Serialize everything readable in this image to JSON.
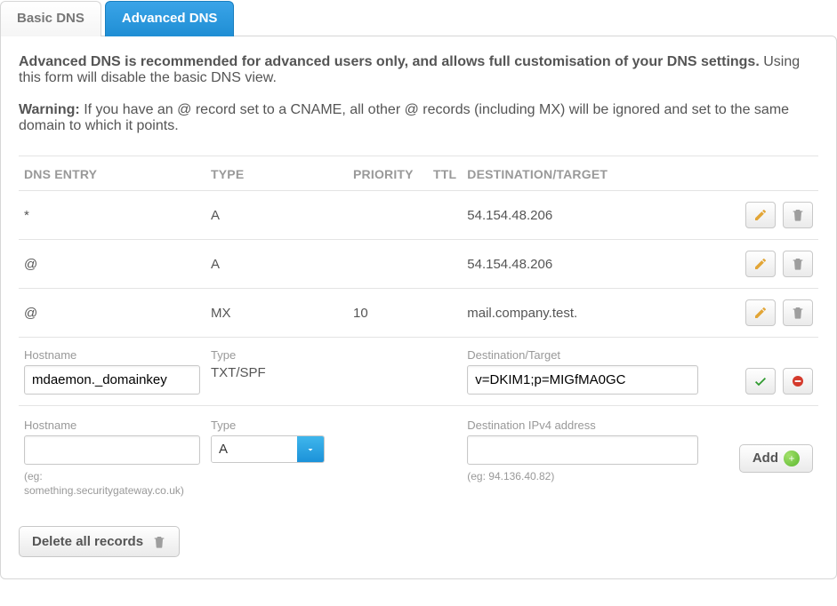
{
  "tabs": {
    "basic": "Basic DNS",
    "advanced": "Advanced DNS"
  },
  "intro": {
    "bold": "Advanced DNS is recommended for advanced users only, and allows full customisation of your DNS settings.",
    "rest": "Using this form will disable the basic DNS view."
  },
  "warning": {
    "label": "Warning:",
    "text": "If you have an @ record set to a CNAME, all other @ records (including MX) will be ignored and set to the same domain to which it points."
  },
  "headers": {
    "entry": "DNS ENTRY",
    "type": "TYPE",
    "priority": "PRIORITY",
    "ttl": "TTL",
    "dest": "DESTINATION/TARGET"
  },
  "rows": [
    {
      "entry": "*",
      "type": "A",
      "priority": "",
      "ttl": "",
      "dest": "54.154.48.206"
    },
    {
      "entry": "@",
      "type": "A",
      "priority": "",
      "ttl": "",
      "dest": "54.154.48.206"
    },
    {
      "entry": "@",
      "type": "MX",
      "priority": "10",
      "ttl": "",
      "dest": "mail.company.test."
    }
  ],
  "edit": {
    "host_label": "Hostname",
    "host_value": "mdaemon._domainkey",
    "type_label": "Type",
    "type_value": "TXT/SPF",
    "dest_label": "Destination/Target",
    "dest_value": "v=DKIM1;p=MIGfMA0GC"
  },
  "add": {
    "host_label": "Hostname",
    "host_hint": "(eg: something.securitygateway.co.uk)",
    "type_label": "Type",
    "type_value": "A",
    "dest_label": "Destination IPv4 address",
    "dest_hint": "(eg: 94.136.40.82)",
    "button": "Add"
  },
  "delete_all": "Delete all records"
}
